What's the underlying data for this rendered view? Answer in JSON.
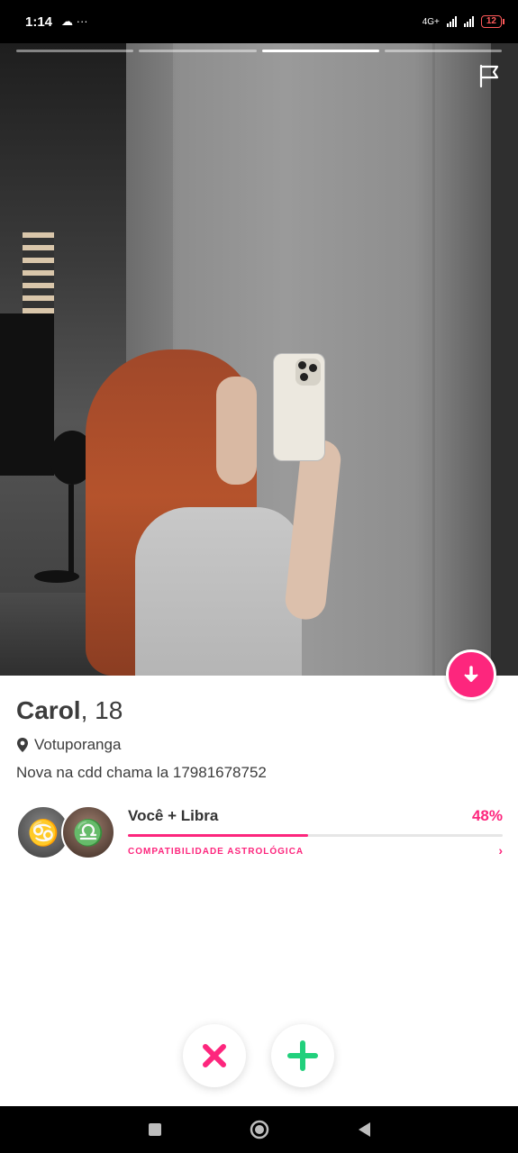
{
  "status_bar": {
    "time": "1:14",
    "extra_icons": "☁ ···",
    "network": "4G+",
    "battery": "12"
  },
  "photo": {
    "segments_total": 4,
    "active_segment": 3,
    "flag_icon": "flag-icon"
  },
  "profile": {
    "name": "Carol",
    "age": ", 18",
    "location": "Votuporanga",
    "bio": "Nova na cdd chama la 17981678752"
  },
  "astrology": {
    "title": "Você + Libra",
    "percent_label": "48%",
    "percent": 48,
    "subtitle": "COMPATIBILIDADE ASTROLÓGICA",
    "sign_user": "♋",
    "sign_match": "♎"
  },
  "colors": {
    "accent": "#fd267d",
    "nope": "#fd267d",
    "like": "#21d07c"
  },
  "actions": {
    "nope_icon": "x-icon",
    "like_icon": "plus-icon"
  }
}
